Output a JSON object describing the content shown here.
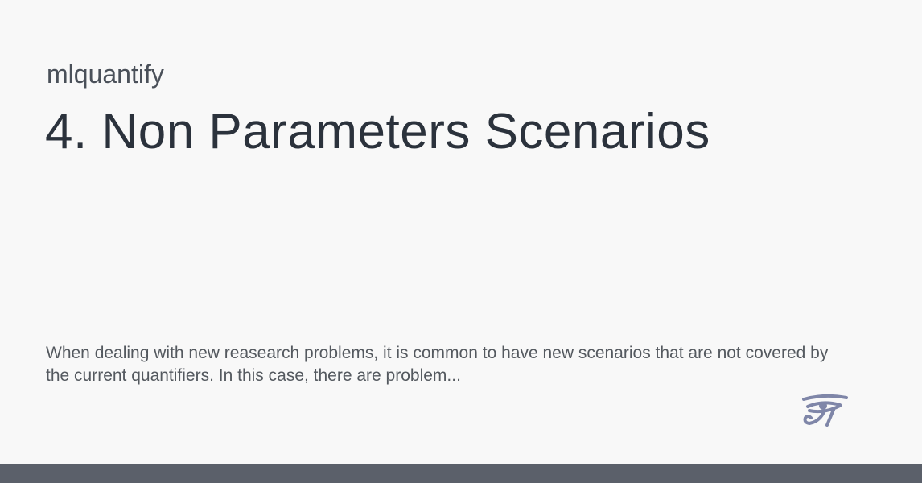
{
  "site": {
    "name": "mlquantify"
  },
  "page": {
    "title": "4. Non Parameters Scenarios",
    "description": "When dealing with new reasearch problems, it is common to have new scenarios that are not covered by the current quantifiers. In this case, there are problem..."
  },
  "logo": {
    "icon": "eye-of-horus-icon",
    "color": "#7f86a8"
  },
  "footer": {
    "color": "#5b606a"
  }
}
